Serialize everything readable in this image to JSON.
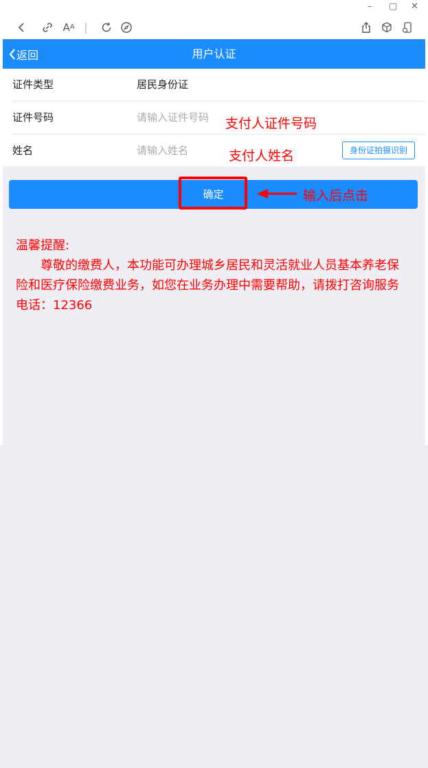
{
  "window": {
    "minimize": "–",
    "maximize": "▢",
    "close": "✕"
  },
  "toolbar": {
    "back": "back-icon",
    "link": "link-icon",
    "font": "font-size-icon",
    "refresh": "refresh-icon",
    "compass": "compass-icon",
    "share": "share-icon",
    "box": "box-icon",
    "phone": "device-icon"
  },
  "header": {
    "back_label": "返回",
    "title": "用户认证"
  },
  "form": {
    "id_type_label": "证件类型",
    "id_type_value": "居民身份证",
    "id_number_label": "证件号码",
    "id_number_placeholder": "请输入证件号码",
    "name_label": "姓名",
    "name_placeholder": "请输入姓名",
    "ocr_button": "身份证拍摄识别"
  },
  "confirm_button": "确定",
  "annotations": {
    "id_hint": "支付人证件号码",
    "name_hint": "支付人姓名",
    "click_hint": "输入后点击"
  },
  "tips": {
    "heading": "温馨提醒:",
    "body": "尊敬的缴费人，本功能可办理城乡居民和灵活就业人员基本养老保险和医疗保险缴费业务，如您在业务办理中需要帮助，请拨打咨询服务电话：12366"
  },
  "colors": {
    "accent": "#1a8cff",
    "annotation": "#ff0000",
    "background": "#efeef4"
  }
}
